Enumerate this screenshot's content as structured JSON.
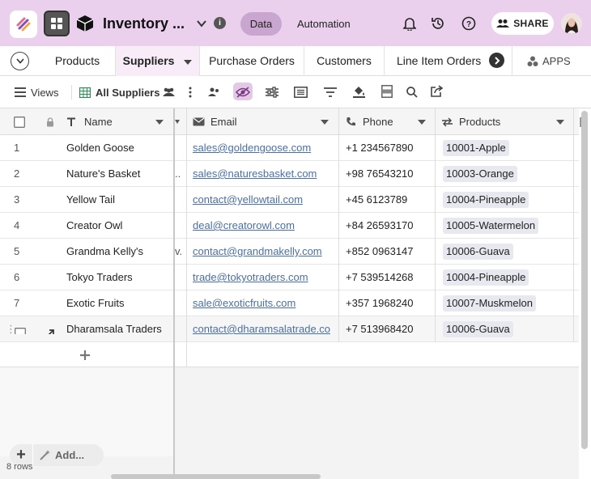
{
  "header": {
    "base_title": "Inventory ...",
    "tab_data": "Data",
    "tab_automation": "Automation",
    "share_label": "SHARE",
    "colors": {
      "header_bg": "#ebd0ee",
      "active_pill": "#c9a6cf"
    }
  },
  "table_tabs": {
    "items": [
      "Products",
      "Suppliers",
      "Purchase Orders",
      "Customers",
      "Line Item Orders"
    ],
    "active": "Suppliers",
    "apps_label": "APPS"
  },
  "toolbar": {
    "views_label": "Views",
    "view_name": "All Suppliers"
  },
  "columns": {
    "name": "Name",
    "email": "Email",
    "phone": "Phone",
    "products": "Products"
  },
  "rows": [
    {
      "num": "1",
      "name": "Golden Goose",
      "trunc": "",
      "email": "sales@goldengoose.com",
      "phone": "+1 234567890",
      "product": "10001-Apple"
    },
    {
      "num": "2",
      "name": "Nature's Basket",
      "trunc": "..",
      "email": "sales@naturesbasket.com",
      "phone": "+98 76543210",
      "product": "10003-Orange"
    },
    {
      "num": "3",
      "name": "Yellow Tail",
      "trunc": "",
      "email": "contact@yellowtail.com",
      "phone": "+45 6123789",
      "product": "10004-Pineapple"
    },
    {
      "num": "4",
      "name": "Creator Owl",
      "trunc": "",
      "email": "deal@creatorowl.com",
      "phone": "+84 26593170",
      "product": "10005-Watermelon"
    },
    {
      "num": "5",
      "name": "Grandma Kelly's",
      "trunc": "v.",
      "email": "contact@grandmakelly.com",
      "phone": "+852 0963147",
      "product": "10006-Guava"
    },
    {
      "num": "6",
      "name": "Tokyo Traders",
      "trunc": "",
      "email": "trade@tokyotraders.com",
      "phone": "+7 539514268",
      "product": "10004-Pineapple"
    },
    {
      "num": "7",
      "name": "Exotic Fruits",
      "trunc": "",
      "email": "sale@exoticfruits.com",
      "phone": "+357 1968240",
      "product": "10007-Muskmelon"
    },
    {
      "num": "",
      "name": "Dharamsala Traders",
      "trunc": "",
      "email": "contact@dharamsalatrade.co",
      "phone": "+7 513968420",
      "product": "10006-Guava"
    }
  ],
  "footer": {
    "add_label": "Add...",
    "row_count": "8 rows"
  }
}
